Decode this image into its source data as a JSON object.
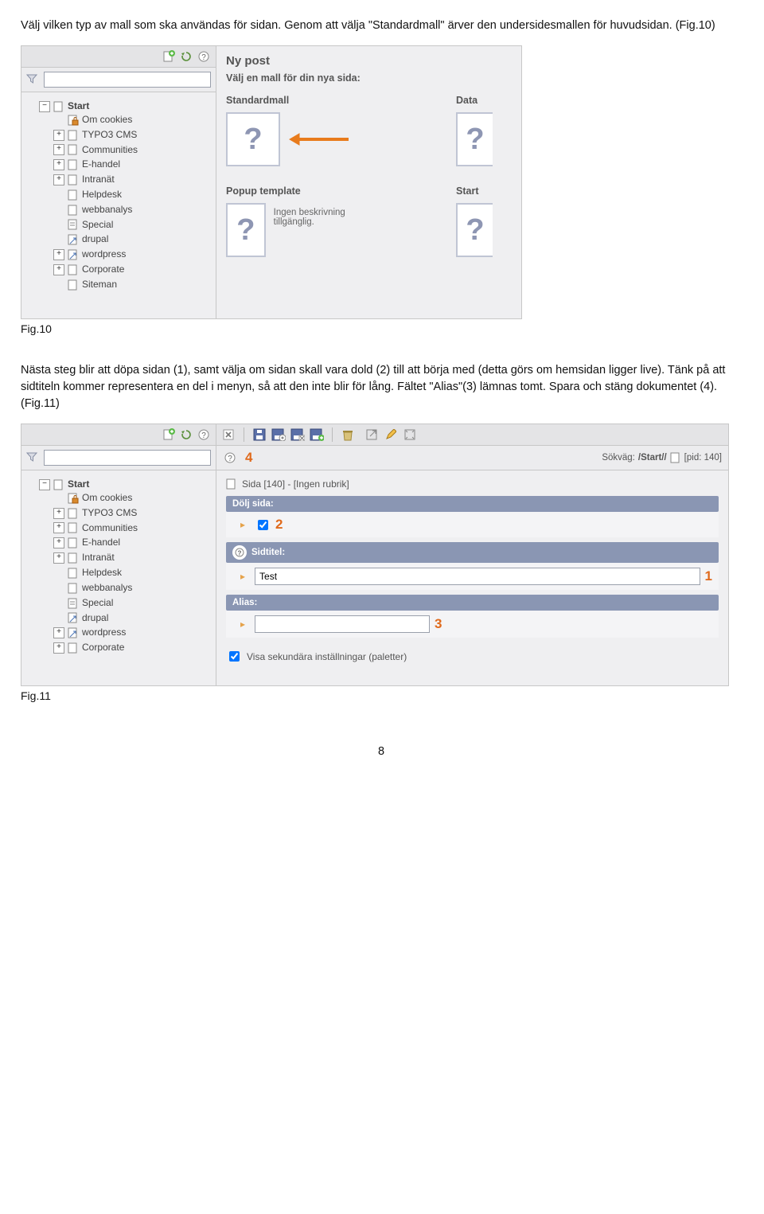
{
  "para1_prefix": "Välj vilken typ av mall som ska användas för sidan. Genom att välja ",
  "para1_quote": "\"Standardmall\"",
  "para1_suffix": " ärver den undersidesmallen för huvudsidan. (Fig.10)",
  "fig10_label": "Fig.10",
  "para2": "Nästa steg blir att döpa sidan (1), samt välja om sidan skall vara dold (2) till att börja med (detta görs om hemsidan ligger live). Tänk på att sidtiteln kommer representera en del i menyn, så att den inte blir för lång. Fältet \"Alias\"(3) lämnas tomt. Spara och stäng dokumentet (4). (Fig.11)",
  "fig11_label": "Fig.11",
  "page_number": "8",
  "tree": {
    "root": "Start",
    "items": [
      {
        "exp": "",
        "label": "Om cookies",
        "icon": "locked"
      },
      {
        "exp": "+",
        "label": "TYPO3 CMS",
        "icon": "page"
      },
      {
        "exp": "+",
        "label": "Communities",
        "icon": "page"
      },
      {
        "exp": "+",
        "label": "E-handel",
        "icon": "page"
      },
      {
        "exp": "+",
        "label": "Intranät",
        "icon": "page"
      },
      {
        "exp": "",
        "label": "Helpdesk",
        "icon": "page"
      },
      {
        "exp": "",
        "label": "webbanalys",
        "icon": "page"
      },
      {
        "exp": "",
        "label": "Special",
        "icon": "special"
      },
      {
        "exp": "",
        "label": "drupal",
        "icon": "shortcut"
      },
      {
        "exp": "+",
        "label": "wordpress",
        "icon": "shortcut"
      },
      {
        "exp": "+",
        "label": "Corporate",
        "icon": "page"
      },
      {
        "exp": "",
        "label": "Siteman",
        "icon": "page"
      }
    ]
  },
  "tree11": {
    "root": "Start",
    "items": [
      {
        "exp": "",
        "label": "Om cookies",
        "icon": "locked"
      },
      {
        "exp": "+",
        "label": "TYPO3 CMS",
        "icon": "page"
      },
      {
        "exp": "+",
        "label": "Communities",
        "icon": "page"
      },
      {
        "exp": "+",
        "label": "E-handel",
        "icon": "page"
      },
      {
        "exp": "+",
        "label": "Intranät",
        "icon": "page"
      },
      {
        "exp": "",
        "label": "Helpdesk",
        "icon": "page"
      },
      {
        "exp": "",
        "label": "webbanalys",
        "icon": "page"
      },
      {
        "exp": "",
        "label": "Special",
        "icon": "special"
      },
      {
        "exp": "",
        "label": "drupal",
        "icon": "shortcut"
      },
      {
        "exp": "+",
        "label": "wordpress",
        "icon": "shortcut"
      },
      {
        "exp": "+",
        "label": "Corporate",
        "icon": "page"
      }
    ]
  },
  "fig10": {
    "title": "Ny post",
    "subtitle": "Välj en mall för din nya sida:",
    "tmpl1": "Standardmall",
    "tmpl2": "Data",
    "tmpl3": "Popup template",
    "tmpl4": "Start",
    "desc": "Ingen beskrivning tillgänglig."
  },
  "fig11": {
    "annot4": "4",
    "sokvag_label": "Sökväg:",
    "sokvag_path": "/Start//",
    "pid": "[pid: 140]",
    "crumb": "Sida [140] - [Ingen rubrik]",
    "sec_dolj": "Dölj sida:",
    "annot2": "2",
    "sec_titel": "Sidtitel:",
    "titel_value": "Test",
    "annot1": "1",
    "sec_alias": "Alias:",
    "annot3": "3",
    "cb_label": "Visa sekundära inställningar (paletter)"
  }
}
